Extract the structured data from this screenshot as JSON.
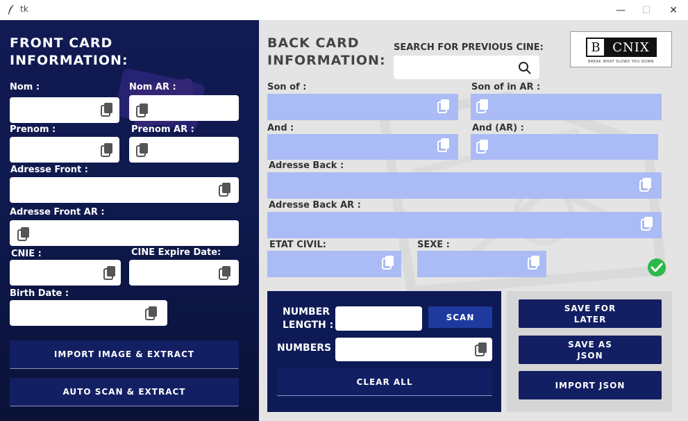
{
  "window": {
    "title": "tk",
    "minimize": "—",
    "maximize": "☐",
    "close": "✕"
  },
  "front": {
    "heading_line1": "FRONT CARD",
    "heading_line2": "INFORMATION:",
    "nom": "Nom :",
    "nom_ar": "Nom AR :",
    "prenom": "Prenom :",
    "prenom_ar": "Prenom AR :",
    "adresse_front": "Adresse Front :",
    "adresse_front_ar": "Adresse Front AR :",
    "cnie": "CNIE :",
    "cine_expire": "CINE Expire Date:",
    "birth_date": "Birth Date :",
    "import_btn": "IMPORT IMAGE & EXTRACT",
    "auto_scan_btn": "AUTO SCAN & EXTRACT"
  },
  "back": {
    "heading_line1": "BACK CARD",
    "heading_line2": "INFORMATION:",
    "search_label": "SEARCH FOR PREVIOUS CINE:",
    "son_of": "Son of :",
    "son_of_ar": "Son of in AR :",
    "and": "And :",
    "and_ar": "And (AR) :",
    "adresse_back": "Adresse Back :",
    "adresse_back_ar": "Adresse Back AR :",
    "etat_civil": "ETAT CIVIL:",
    "sexe": "SEXE :"
  },
  "logo": {
    "letter": "B",
    "name": "CNIX",
    "tagline": "BREAK WHAT SLOWS YOU DOWN"
  },
  "scan": {
    "number_length_line1": "NUMBER",
    "number_length_line2": "LENGTH  :",
    "scan_btn": "SCAN",
    "numbers": "NUMBERS :",
    "clear_btn": "CLEAR ALL"
  },
  "save": {
    "save_later_line1": "SAVE FOR",
    "save_later_line2": "LATER",
    "save_json_line1": "SAVE AS",
    "save_json_line2": "JSON",
    "import_json": "IMPORT JSON"
  },
  "colors": {
    "navy": "#111a52",
    "button": "#131f63",
    "field_blue": "#aabbf5",
    "panel_gray": "#e4e4e4",
    "check_green": "#2db84a"
  }
}
